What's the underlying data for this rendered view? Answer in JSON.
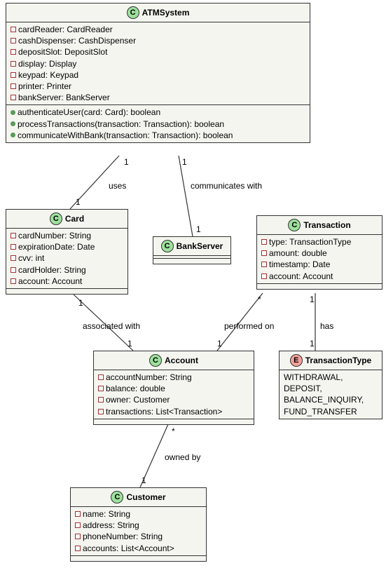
{
  "chart_data": {
    "type": "uml-class-diagram",
    "classes": [
      {
        "name": "ATMSystem",
        "kind": "class",
        "attributes": [
          "cardReader: CardReader",
          "cashDispenser: CashDispenser",
          "depositSlot: DepositSlot",
          "display: Display",
          "keypad: Keypad",
          "printer: Printer",
          "bankServer: BankServer"
        ],
        "methods": [
          "authenticateUser(card: Card): boolean",
          "processTransactions(transaction: Transaction): boolean",
          "communicateWithBank(transaction: Transaction): boolean"
        ]
      },
      {
        "name": "Card",
        "kind": "class",
        "attributes": [
          "cardNumber: String",
          "expirationDate: Date",
          "cvv: int",
          "cardHolder: String",
          "account: Account"
        ],
        "methods": []
      },
      {
        "name": "BankServer",
        "kind": "class",
        "attributes": [],
        "methods": []
      },
      {
        "name": "Transaction",
        "kind": "class",
        "attributes": [
          "type: TransactionType",
          "amount: double",
          "timestamp: Date",
          "account: Account"
        ],
        "methods": []
      },
      {
        "name": "Account",
        "kind": "class",
        "attributes": [
          "accountNumber: String",
          "balance: double",
          "owner: Customer",
          "transactions: List<Transaction>"
        ],
        "methods": []
      },
      {
        "name": "Customer",
        "kind": "class",
        "attributes": [
          "name: String",
          "address: String",
          "phoneNumber: String",
          "accounts: List<Account>"
        ],
        "methods": []
      },
      {
        "name": "TransactionType",
        "kind": "enum",
        "values": [
          "WITHDRAWAL",
          "DEPOSIT",
          "BALANCE_INQUIRY",
          "FUND_TRANSFER"
        ]
      }
    ],
    "relations": [
      {
        "from": "ATMSystem",
        "to": "Card",
        "label": "uses",
        "fromMult": "1",
        "toMult": "1"
      },
      {
        "from": "ATMSystem",
        "to": "BankServer",
        "label": "communicates with",
        "fromMult": "1",
        "toMult": "1"
      },
      {
        "from": "Card",
        "to": "Account",
        "label": "associated with",
        "fromMult": "1",
        "toMult": "1"
      },
      {
        "from": "Transaction",
        "to": "Account",
        "label": "performed on",
        "fromMult": "*",
        "toMult": "1"
      },
      {
        "from": "Transaction",
        "to": "TransactionType",
        "label": "has",
        "fromMult": "1",
        "toMult": "1"
      },
      {
        "from": "Account",
        "to": "Customer",
        "label": "owned by",
        "fromMult": "*",
        "toMult": "1"
      }
    ]
  },
  "atm": {
    "title": "ATMSystem",
    "a0": "cardReader: CardReader",
    "a1": "cashDispenser: CashDispenser",
    "a2": "depositSlot: DepositSlot",
    "a3": "display: Display",
    "a4": "keypad: Keypad",
    "a5": "printer: Printer",
    "a6": "bankServer: BankServer",
    "m0": "authenticateUser(card: Card): boolean",
    "m1": "processTransactions(transaction: Transaction): boolean",
    "m2": "communicateWithBank(transaction: Transaction): boolean"
  },
  "card": {
    "title": "Card",
    "a0": "cardNumber: String",
    "a1": "expirationDate: Date",
    "a2": "cvv: int",
    "a3": "cardHolder: String",
    "a4": "account: Account"
  },
  "bank": {
    "title": "BankServer"
  },
  "txn": {
    "title": "Transaction",
    "a0": "type: TransactionType",
    "a1": "amount: double",
    "a2": "timestamp: Date",
    "a3": "account: Account"
  },
  "acct": {
    "title": "Account",
    "a0": "accountNumber: String",
    "a1": "balance: double",
    "a2": "owner: Customer",
    "a3": "transactions: List<Transaction>"
  },
  "cust": {
    "title": "Customer",
    "a0": "name: String",
    "a1": "address: String",
    "a2": "phoneNumber: String",
    "a3": "accounts: List<Account>"
  },
  "ttype": {
    "title": "TransactionType",
    "v0": "WITHDRAWAL,",
    "v1": "DEPOSIT,",
    "v2": "BALANCE_INQUIRY,",
    "v3": "FUND_TRANSFER"
  },
  "rel": {
    "uses": "uses",
    "comm": "communicates with",
    "assoc": "associated with",
    "perf": "performed on",
    "has": "has",
    "owned": "owned by",
    "one": "1",
    "star": "*"
  }
}
